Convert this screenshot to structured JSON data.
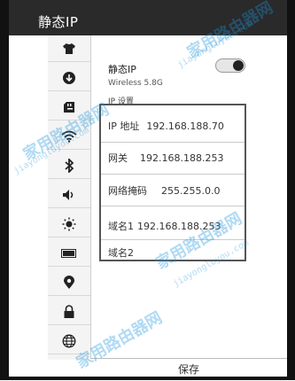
{
  "titlebar": {
    "title": "静态IP"
  },
  "sidebar": {
    "items": [
      {
        "icon": "shirt-icon"
      },
      {
        "icon": "cloud-download-icon"
      },
      {
        "icon": "sd-card-icon"
      },
      {
        "icon": "wifi-icon"
      },
      {
        "icon": "bluetooth-icon"
      },
      {
        "icon": "volume-icon"
      },
      {
        "icon": "brightness-icon"
      },
      {
        "icon": "battery-icon"
      },
      {
        "icon": "location-icon"
      },
      {
        "icon": "lock-icon"
      },
      {
        "icon": "globe-icon"
      }
    ]
  },
  "setting": {
    "title": "静态IP",
    "subtitle": "Wireless 5.8G",
    "section": "IP 设置",
    "toggle_on": true
  },
  "fields": [
    {
      "label": "IP 地址",
      "value": "192.168.188.70"
    },
    {
      "label": "网关",
      "value": "192.168.188.253"
    },
    {
      "label": "网络掩码",
      "value": "255.255.0.0"
    },
    {
      "label": "域名1",
      "value": "192.168.188.253"
    },
    {
      "label": "域名2",
      "value": ""
    }
  ],
  "actions": {
    "save_label": "保存"
  },
  "watermark": {
    "text": "家用路由器网",
    "url": "jiayongluyou.com"
  },
  "colors": {
    "titlebar": "#2a2a2a",
    "highlight_border": "#555555",
    "watermark": "#1e96dc"
  }
}
